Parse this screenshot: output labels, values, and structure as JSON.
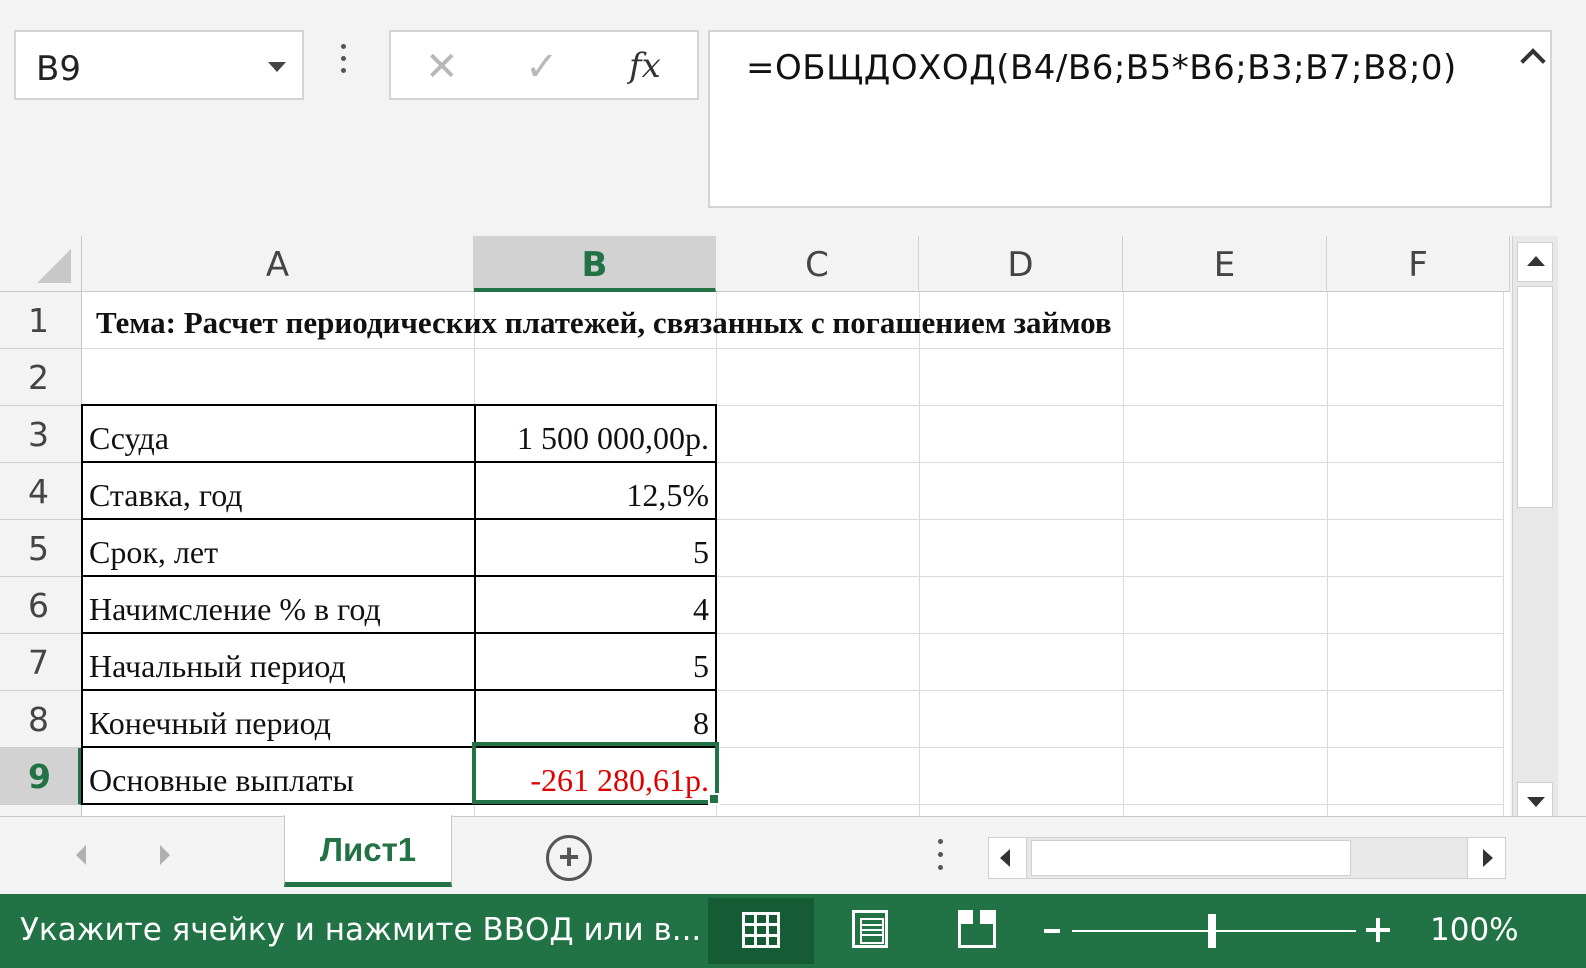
{
  "formula_bar": {
    "name_box": "B9",
    "cancel_glyph": "✕",
    "enter_glyph": "✓",
    "fx_label": "fx",
    "formula": "=ОБЩДОХОД(B4/B6;B5*B6;B3;B7;B8;0)"
  },
  "columns": [
    "A",
    "B",
    "C",
    "D",
    "E",
    "F"
  ],
  "selected_column": "B",
  "rows": [
    "1",
    "2",
    "3",
    "4",
    "5",
    "6",
    "7",
    "8",
    "9"
  ],
  "selected_row": "9",
  "cells": {
    "A1": "Тема: Расчет периодических платежей, связанных с погашением займов",
    "A3": "Ссуда",
    "B3": "1 500 000,00р.",
    "A4": "Ставка, год",
    "B4": "12,5%",
    "A5": "Срок, лет",
    "B5": "5",
    "A6": "Начимсление % в год",
    "B6": "4",
    "A7": "Начальный период",
    "B7": "5",
    "A8": "Конечный период",
    "B8": "8",
    "A9": "Основные выплаты",
    "B9": "-261 280,61р."
  },
  "colors": {
    "accent": "#217346",
    "negative": "#e00000"
  },
  "sheet_tabs": {
    "active": "Лист1",
    "add_glyph": "+"
  },
  "status_bar": {
    "message": "Укажите ячейку и нажмите ВВОД или в...",
    "views": [
      "normal-view-icon",
      "page-layout-icon",
      "page-break-icon"
    ],
    "zoom": "100%"
  }
}
